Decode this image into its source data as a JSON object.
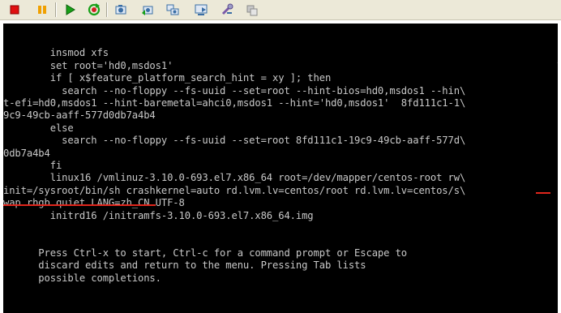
{
  "toolbar": {
    "buttons": [
      {
        "name": "stop-icon",
        "color": "#e01010"
      },
      {
        "name": "pause-icon",
        "color": "#f0a000"
      },
      {
        "name": "play-icon",
        "color": "#18a018"
      },
      {
        "name": "reset-icon",
        "color": "#d02020"
      },
      {
        "name": "snapshot-icon",
        "color": "#3a6ea5"
      },
      {
        "name": "revert-snapshot-icon",
        "color": "#3a6ea5"
      },
      {
        "name": "snapshot-manager-icon",
        "color": "#3a6ea5"
      },
      {
        "name": "console-view-icon",
        "color": "#3a6ea5"
      },
      {
        "name": "settings-icon",
        "color": "#7a5aa8"
      },
      {
        "name": "unity-icon",
        "color": "#8a8a8a"
      }
    ]
  },
  "console": {
    "lines": [
      "",
      "        insmod xfs",
      "        set root='hd0,msdos1'",
      "        if [ x$feature_platform_search_hint = xy ]; then",
      "          search --no-floppy --fs-uuid --set=root --hint-bios=hd0,msdos1 --hin\\",
      "t-efi=hd0,msdos1 --hint-baremetal=ahci0,msdos1 --hint='hd0,msdos1'  8fd111c1-1\\",
      "9c9-49cb-aaff-577d0db7a4b4",
      "        else",
      "          search --no-floppy --fs-uuid --set=root 8fd111c1-19c9-49cb-aaff-577d\\",
      "0db7a4b4",
      "        fi",
      "        linux16 /vmlinuz-3.10.0-693.el7.x86_64 root=/dev/mapper/centos-root rw\\",
      "init=/sysroot/bin/sh crashkernel=auto rd.lvm.lv=centos/root rd.lvm.lv=centos/s\\",
      "wap rhgb quiet LANG=zh_CN.UTF-8",
      "        initrd16 /initramfs-3.10.0-693.el7.x86_64.img",
      "",
      "",
      "      Press Ctrl-x to start, Ctrl-c for a command prompt or Escape to",
      "      discard edits and return to the menu. Pressing Tab lists",
      "      possible completions."
    ],
    "scroll_indicator": "↑",
    "text_color": "#c8c8c8",
    "background": "#000000",
    "annotation_color": "#e0261c"
  }
}
